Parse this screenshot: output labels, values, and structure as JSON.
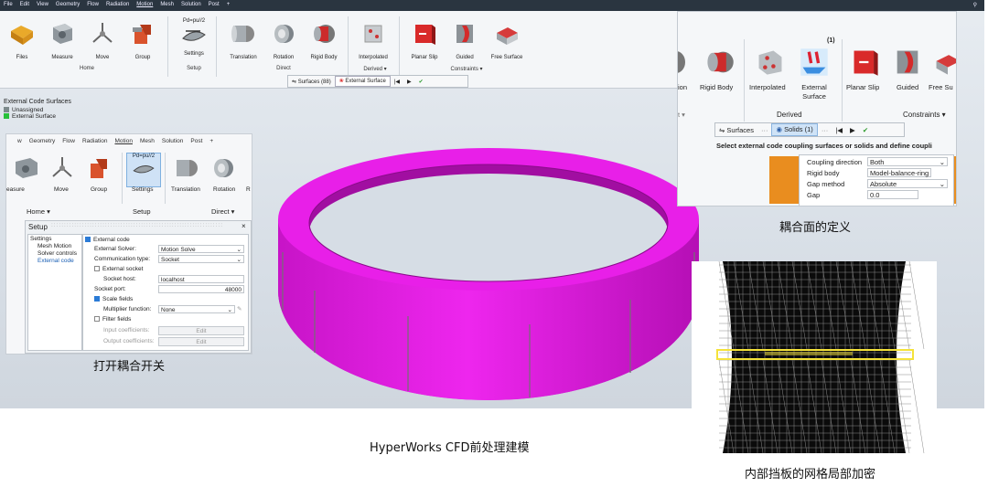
{
  "menu": [
    "File",
    "Edit",
    "View",
    "Geometry",
    "Flow",
    "Radiation",
    "Motion",
    "Mesh",
    "Solution",
    "Post",
    "+"
  ],
  "ribbon": {
    "tools": [
      "Files",
      "Measure",
      "Move",
      "Group",
      "Settings",
      "Translation",
      "Rotation",
      "Rigid Body",
      "Interpolated",
      "Planar Slip",
      "Guided",
      "Free Surface"
    ],
    "settings_formula": "Pd=pu//2",
    "groups": {
      "home": "Home",
      "setup": "Setup",
      "direct": "Direct",
      "derived": "Derived ▾",
      "constraints": "Constraints ▾"
    },
    "selbar": {
      "surfaces": "Surfaces (88)",
      "external": "External Surface"
    }
  },
  "legend": {
    "title": "External Code Surfaces",
    "items": [
      {
        "label": "Unassigned",
        "color": "#7d8a8c"
      },
      {
        "label": "External Surface",
        "color": "#27c03a"
      }
    ]
  },
  "inset1": {
    "menu": [
      "w",
      "Geometry",
      "Flow",
      "Radiation",
      "Motion",
      "Mesh",
      "Solution",
      "Post",
      "+"
    ],
    "tools": [
      "easure",
      "Move",
      "Group",
      "Settings",
      "Translation",
      "Rotation",
      "R"
    ],
    "formula": "Pd=pu//2",
    "groups": {
      "home": "Home ▾",
      "setup": "Setup",
      "direct": "Direct ▾"
    },
    "setup_title": "Setup",
    "tree": [
      "Settings",
      "Mesh Motion",
      "Solver controls",
      "External code"
    ],
    "form": {
      "external_code": "External code",
      "solver_label": "External Solver:",
      "solver_value": "Motion Solve",
      "comm_label": "Communication type:",
      "comm_value": "Socket",
      "ext_socket": "External socket",
      "host_label": "Socket host:",
      "host_value": "localhost",
      "port_label": "Socket port:",
      "port_value": "48000",
      "scale": "Scale fields",
      "mult_label": "Multiplier function:",
      "mult_value": "None",
      "filter": "Filter fields",
      "in_label": "Input coefficients:",
      "out_label": "Output coefficients:",
      "edit": "Edit"
    },
    "caption": "打开耦合开关"
  },
  "inset2": {
    "tools": [
      "ion",
      "Rigid Body",
      "Interpolated",
      "External Surface",
      "Planar Slip",
      "Guided",
      "Free Su"
    ],
    "badge": "(1)",
    "groups": {
      "left": "t ▾",
      "derived": "Derived",
      "constraints": "Constraints ▾"
    },
    "selbar": {
      "surfaces": "Surfaces",
      "solids": "Solids (1)"
    },
    "instruction": "Select external code coupling surfaces or solids and define coupli",
    "props": [
      {
        "label": "Coupling direction",
        "value": "Both"
      },
      {
        "label": "Rigid body",
        "value": "Model-balance-ring"
      },
      {
        "label": "Gap method",
        "value": "Absolute"
      },
      {
        "label": "Gap",
        "value": "0.0"
      }
    ],
    "caption": "耦合面的定义"
  },
  "center_caption": "HyperWorks CFD前处理建模",
  "mesh_caption": "内部挡板的网格局部加密",
  "colors": {
    "ring": "#e61be6",
    "ring_dark": "#b010b0",
    "ring_light": "#f25cf2",
    "accent": "#2b7bd6"
  }
}
